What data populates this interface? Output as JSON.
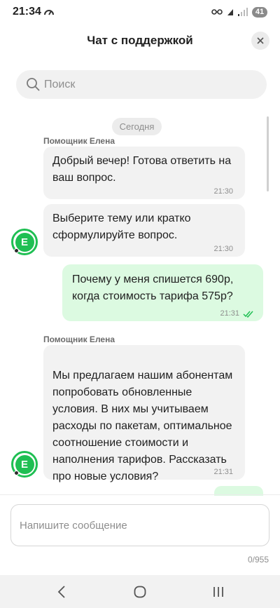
{
  "status_bar": {
    "time": "21:34",
    "battery": "41"
  },
  "header": {
    "title": "Чат с поддержкой"
  },
  "search": {
    "placeholder": "Поиск"
  },
  "chat": {
    "date_chip": "Сегодня",
    "messages": [
      {
        "direction": "in",
        "sender": "Помощник Елена",
        "text": "Добрый вечер! Готова ответить на ваш вопрос.",
        "time": "21:30"
      },
      {
        "direction": "in",
        "text": "Выберите тему или кратко сформулируйте вопрос.",
        "time": "21:30",
        "avatar_letter": "E"
      },
      {
        "direction": "out",
        "text": "Почему у меня спишется 690р, когда стоимость тарифа 575р?",
        "time": "21:31",
        "status": "read"
      },
      {
        "direction": "in",
        "sender": "Помощник Елена",
        "text": "Мы предлагаем нашим абонентам попробовать обновленные условия. В них мы учитываем расходы по пакетам, оптимальное соотношение стоимости и наполнения тарифов. Рассказать про новые условия?",
        "time": "21:31",
        "avatar_letter": "E"
      }
    ]
  },
  "composer": {
    "placeholder": "Напишите сообщение",
    "counter": "0/955"
  },
  "colors": {
    "accent_green": "#1fbf53",
    "outgoing_bubble": "#dcfae1",
    "incoming_bubble": "#f2f2f2"
  },
  "icons": {
    "status_left": "speedometer-icon",
    "search": "search-icon",
    "close": "close-icon",
    "read_ticks": "double-check-icon",
    "nav_back": "back-icon",
    "nav_home": "home-icon",
    "nav_recents": "recents-icon"
  }
}
